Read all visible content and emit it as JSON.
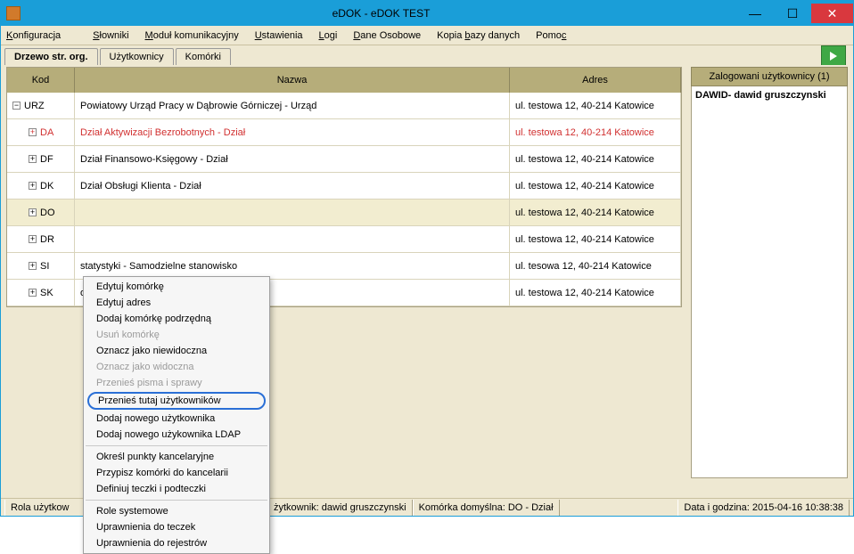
{
  "window": {
    "title": "eDOK - eDOK TEST"
  },
  "menu": {
    "konfiguracja": "Konfiguracja",
    "slowniki": "Słowniki",
    "modul": "Moduł komunikacyjny",
    "ustawienia": "Ustawienia",
    "logi": "Logi",
    "dane": "Dane Osobowe",
    "kopia": "Kopia bazy danych",
    "pomoc": "Pomoc"
  },
  "tabs": {
    "drzewo": "Drzewo str. org.",
    "uzytkownicy": "Użytkownicy",
    "komorki": "Komórki"
  },
  "grid": {
    "headers": {
      "kod": "Kod",
      "nazwa": "Nazwa",
      "adres": "Adres"
    },
    "rows": [
      {
        "kod": "URZ",
        "nazwa": "Powiatowy Urząd Pracy w Dąbrowie Górniczej - Urząd",
        "adres": "ul. testowa 12, 40-214 Katowice",
        "indent": 0,
        "toggle": "−"
      },
      {
        "kod": "DA",
        "nazwa": "Dział Aktywizacji Bezrobotnych - Dział",
        "adres": "ul. testowa 12, 40-214 Katowice",
        "indent": 1,
        "toggle": "+",
        "red": true
      },
      {
        "kod": "DF",
        "nazwa": "Dział Finansowo-Księgowy - Dział",
        "adres": "ul. testowa 12, 40-214 Katowice",
        "indent": 1,
        "toggle": "+"
      },
      {
        "kod": "DK",
        "nazwa": "Dział Obsługi Klienta - Dział",
        "adres": "ul. testowa 12, 40-214 Katowice",
        "indent": 1,
        "toggle": "+"
      },
      {
        "kod": "DO",
        "nazwa": "",
        "adres": "ul. testowa 12, 40-214 Katowice",
        "indent": 1,
        "toggle": "+",
        "selected": true
      },
      {
        "kod": "DR",
        "nazwa": "",
        "adres": "ul. testowa 12, 40-214 Katowice",
        "indent": 1,
        "toggle": "+"
      },
      {
        "kod": "SI",
        "nazwa": "statystyki - Samodzielne stanowisko",
        "adres": "ul. tesowa 12, 40-214 Katowice",
        "indent": 1,
        "toggle": "+",
        "partial": true
      },
      {
        "kod": "SK",
        "nazwa": "odzielne stanowisko",
        "adres": "ul. testowa 12, 40-214 Katowice",
        "indent": 1,
        "toggle": "+",
        "partial": true
      }
    ]
  },
  "context": {
    "items": [
      "Edytuj komórkę",
      "Edytuj adres",
      "Dodaj komórkę podrzędną",
      "Usuń komórkę",
      "Oznacz jako niewidoczna",
      "Oznacz jako widoczna",
      "Przenieś pisma i sprawy",
      "Przenieś tutaj użytkowników",
      "Dodaj nowego użytkownika",
      "Dodaj nowego użykownika LDAP",
      "Określ punkty kancelaryjne",
      "Przypisz komórki do kancelarii",
      "Definiuj teczki i podteczki",
      "Role systemowe",
      "Uprawnienia do teczek",
      "Uprawnienia do rejestrów"
    ]
  },
  "right": {
    "header": "Zalogowani użytkownicy (1)",
    "user": "DAWID- dawid gruszczynski"
  },
  "status": {
    "rola": "Rola użytkow",
    "uzytkownik": "żytkownik: dawid gruszczynski",
    "komorka": "Komórka domyślna: DO - Dział",
    "data": "Data i godzina: 2015-04-16 10:38:38"
  }
}
